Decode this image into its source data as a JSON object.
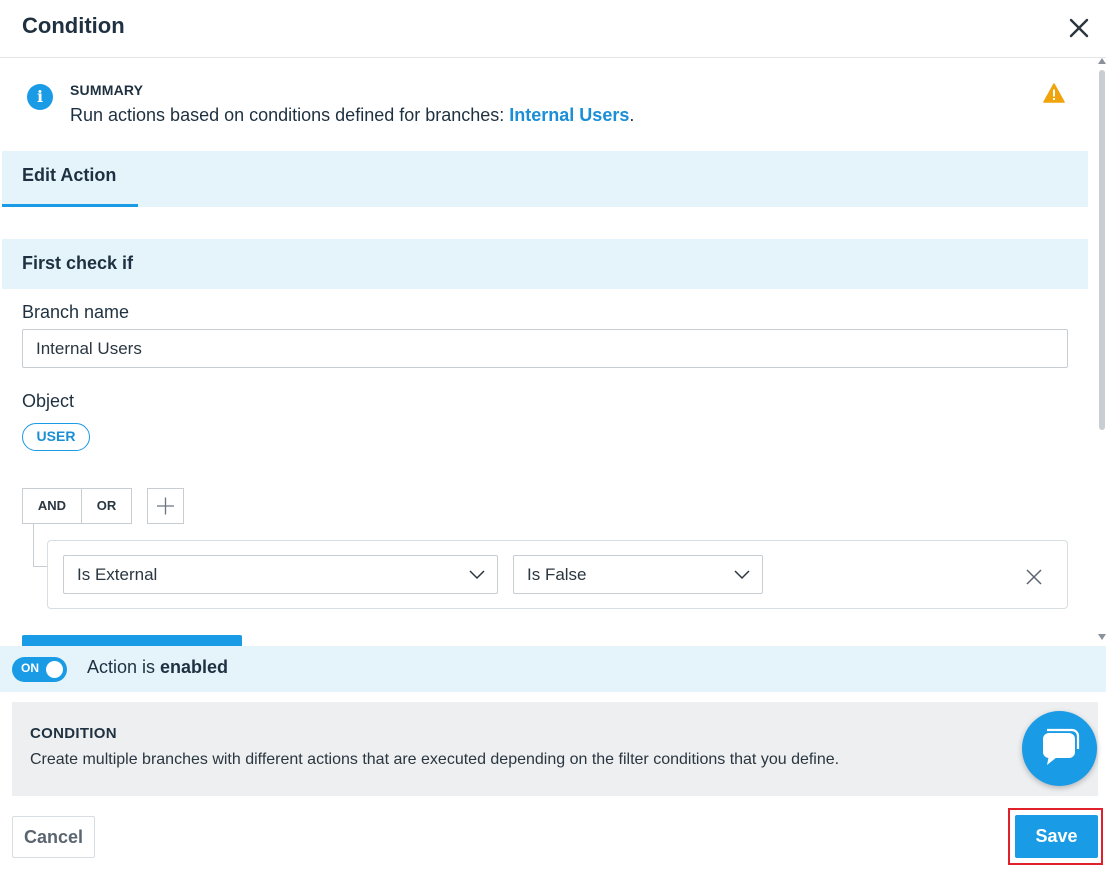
{
  "dialog": {
    "title": "Condition"
  },
  "summary": {
    "label": "SUMMARY",
    "text_prefix": "Run actions based on conditions defined for branches: ",
    "branch_link": "Internal Users",
    "text_suffix": "."
  },
  "tabs": [
    {
      "label": "Edit Action",
      "active": true
    }
  ],
  "section": {
    "heading": "First check if"
  },
  "branch_name": {
    "label": "Branch name",
    "value": "Internal Users"
  },
  "object": {
    "label": "Object",
    "value": "USER"
  },
  "logic": {
    "and_label": "AND",
    "or_label": "OR",
    "add_icon": "plus-icon"
  },
  "condition_row": {
    "field_value": "Is External",
    "operator_value": "Is False",
    "remove_icon": "close-icon"
  },
  "enable": {
    "toggle_label": "ON",
    "text_prefix": "Action is ",
    "text_state": "enabled"
  },
  "info_panel": {
    "title": "CONDITION",
    "description": "Create multiple branches with different actions that are executed depending on the filter conditions that you define."
  },
  "footer": {
    "cancel_label": "Cancel",
    "save_label": "Save"
  },
  "colors": {
    "accent": "#1a9be6",
    "section_bg": "#e5f3fb",
    "warning": "#f0a30a",
    "highlight_frame": "#e0202b"
  }
}
